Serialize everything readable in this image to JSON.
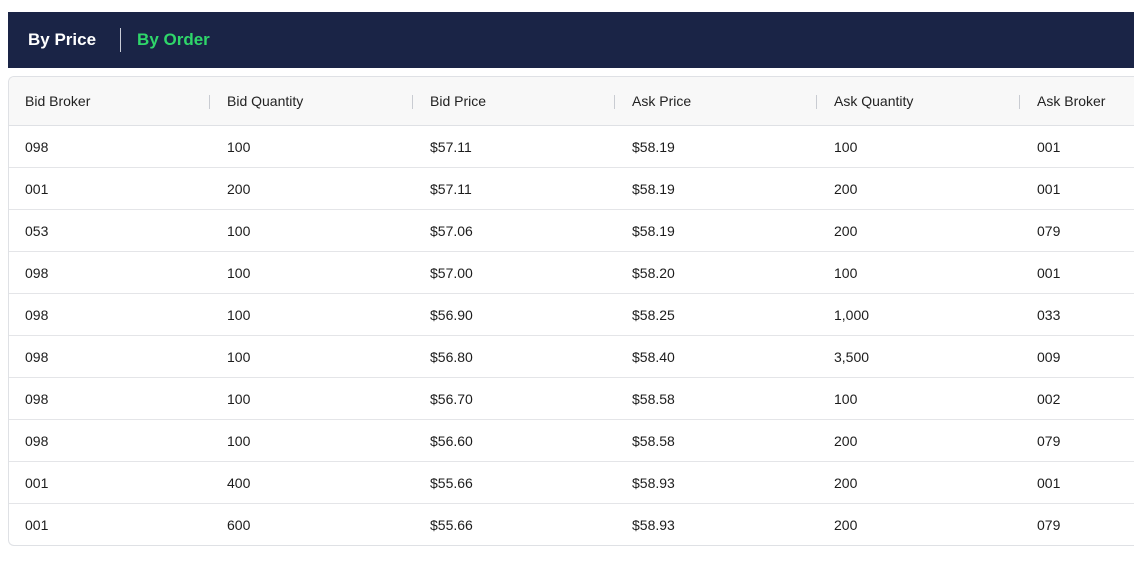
{
  "tabs": {
    "by_price": "By Price",
    "by_order": "By Order",
    "active": "by_order",
    "active_color": "#2fd66a",
    "bar_color": "#1a2446"
  },
  "table": {
    "columns": [
      "Bid Broker",
      "Bid Quantity",
      "Bid Price",
      "Ask Price",
      "Ask Quantity",
      "Ask Broker"
    ],
    "rows": [
      [
        "098",
        "100",
        "$57.11",
        "$58.19",
        "100",
        "001"
      ],
      [
        "001",
        "200",
        "$57.11",
        "$58.19",
        "200",
        "001"
      ],
      [
        "053",
        "100",
        "$57.06",
        "$58.19",
        "200",
        "079"
      ],
      [
        "098",
        "100",
        "$57.00",
        "$58.20",
        "100",
        "001"
      ],
      [
        "098",
        "100",
        "$56.90",
        "$58.25",
        "1,000",
        "033"
      ],
      [
        "098",
        "100",
        "$56.80",
        "$58.40",
        "3,500",
        "009"
      ],
      [
        "098",
        "100",
        "$56.70",
        "$58.58",
        "100",
        "002"
      ],
      [
        "098",
        "100",
        "$56.60",
        "$58.58",
        "200",
        "079"
      ],
      [
        "001",
        "400",
        "$55.66",
        "$58.93",
        "200",
        "001"
      ],
      [
        "001",
        "600",
        "$55.66",
        "$58.93",
        "200",
        "079"
      ]
    ]
  }
}
